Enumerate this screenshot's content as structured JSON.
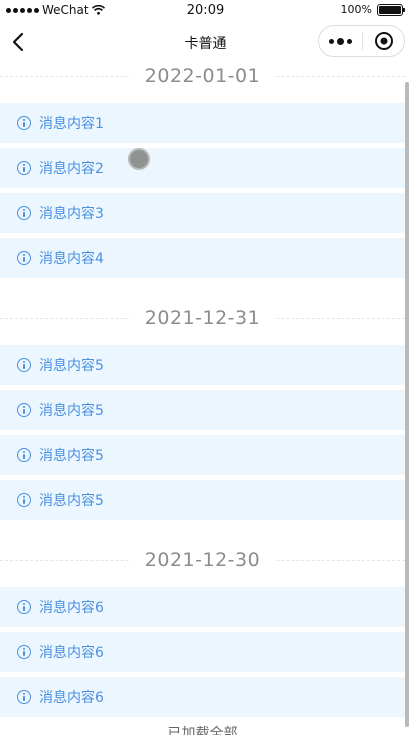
{
  "status_bar": {
    "carrier": "WeChat",
    "time": "20:09",
    "battery_text": "100%",
    "battery_level": 1.0
  },
  "nav": {
    "title": "卡普通",
    "back_icon": "chevron-left-icon",
    "more_icon": "more-dots-icon",
    "close_icon": "target-circle-icon"
  },
  "groups": [
    {
      "date": "2022-01-01",
      "items": [
        "消息内容1",
        "消息内容2",
        "消息内容3",
        "消息内容4"
      ]
    },
    {
      "date": "2021-12-31",
      "items": [
        "消息内容5",
        "消息内容5",
        "消息内容5",
        "消息内容5"
      ]
    },
    {
      "date": "2021-12-30",
      "items": [
        "消息内容6",
        "消息内容6",
        "消息内容6"
      ]
    }
  ],
  "footer": {
    "text": "已加载全部"
  },
  "colors": {
    "item_background": "#ecf6fe",
    "item_text": "#4a90e2",
    "date_text": "#8c8c8c"
  }
}
